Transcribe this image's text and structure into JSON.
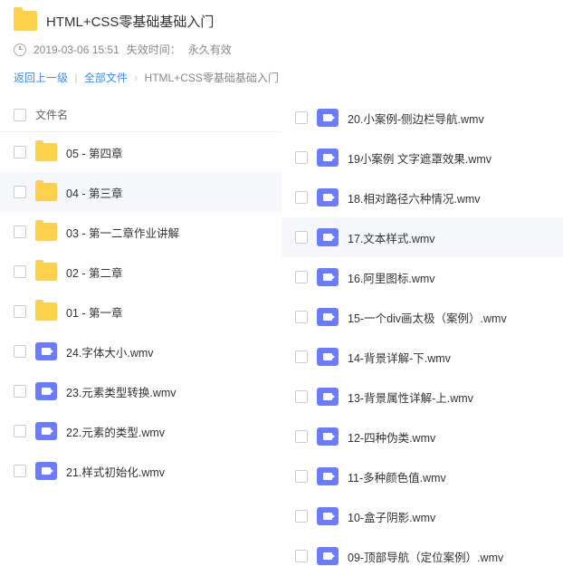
{
  "header": {
    "title": "HTML+CSS零基础基础入门",
    "datetime": "2019-03-06 15:51",
    "expiry_label": "失效时间：",
    "expiry_value": "永久有效"
  },
  "breadcrumb": {
    "back": "返回上一级",
    "all": "全部文件",
    "current": "HTML+CSS零基础基础入门"
  },
  "list_header": {
    "name_col": "文件名"
  },
  "left_items": [
    {
      "type": "folder",
      "name": "05 - 第四章",
      "highlight": false
    },
    {
      "type": "folder",
      "name": "04 - 第三章",
      "highlight": true
    },
    {
      "type": "folder",
      "name": "03 - 第一二章作业讲解",
      "highlight": false
    },
    {
      "type": "folder",
      "name": "02 - 第二章",
      "highlight": false
    },
    {
      "type": "folder",
      "name": "01 - 第一章",
      "highlight": false
    },
    {
      "type": "video",
      "name": "24.字体大小.wmv",
      "highlight": false
    },
    {
      "type": "video",
      "name": "23.元素类型转换.wmv",
      "highlight": false
    },
    {
      "type": "video",
      "name": "22.元素的类型.wmv",
      "highlight": false
    },
    {
      "type": "video",
      "name": "21.样式初始化.wmv",
      "highlight": false
    }
  ],
  "right_items": [
    {
      "type": "video",
      "name": "20.小案例-侧边栏导航.wmv",
      "highlight": false
    },
    {
      "type": "video",
      "name": "19小案例 文字遮罩效果.wmv",
      "highlight": false
    },
    {
      "type": "video",
      "name": "18.相对路径六种情况.wmv",
      "highlight": false
    },
    {
      "type": "video",
      "name": "17.文本样式.wmv",
      "highlight": true
    },
    {
      "type": "video",
      "name": "16.阿里图标.wmv",
      "highlight": false
    },
    {
      "type": "video",
      "name": "15-一个div画太极（案例）.wmv",
      "highlight": false
    },
    {
      "type": "video",
      "name": "14-背景详解-下.wmv",
      "highlight": false
    },
    {
      "type": "video",
      "name": "13-背景属性详解-上.wmv",
      "highlight": false
    },
    {
      "type": "video",
      "name": "12-四种伪类.wmv",
      "highlight": false
    },
    {
      "type": "video",
      "name": "11-多种颜色值.wmv",
      "highlight": false
    },
    {
      "type": "video",
      "name": "10-盒子阴影.wmv",
      "highlight": false
    },
    {
      "type": "video",
      "name": "09-顶部导航（定位案例）.wmv",
      "highlight": false
    }
  ]
}
